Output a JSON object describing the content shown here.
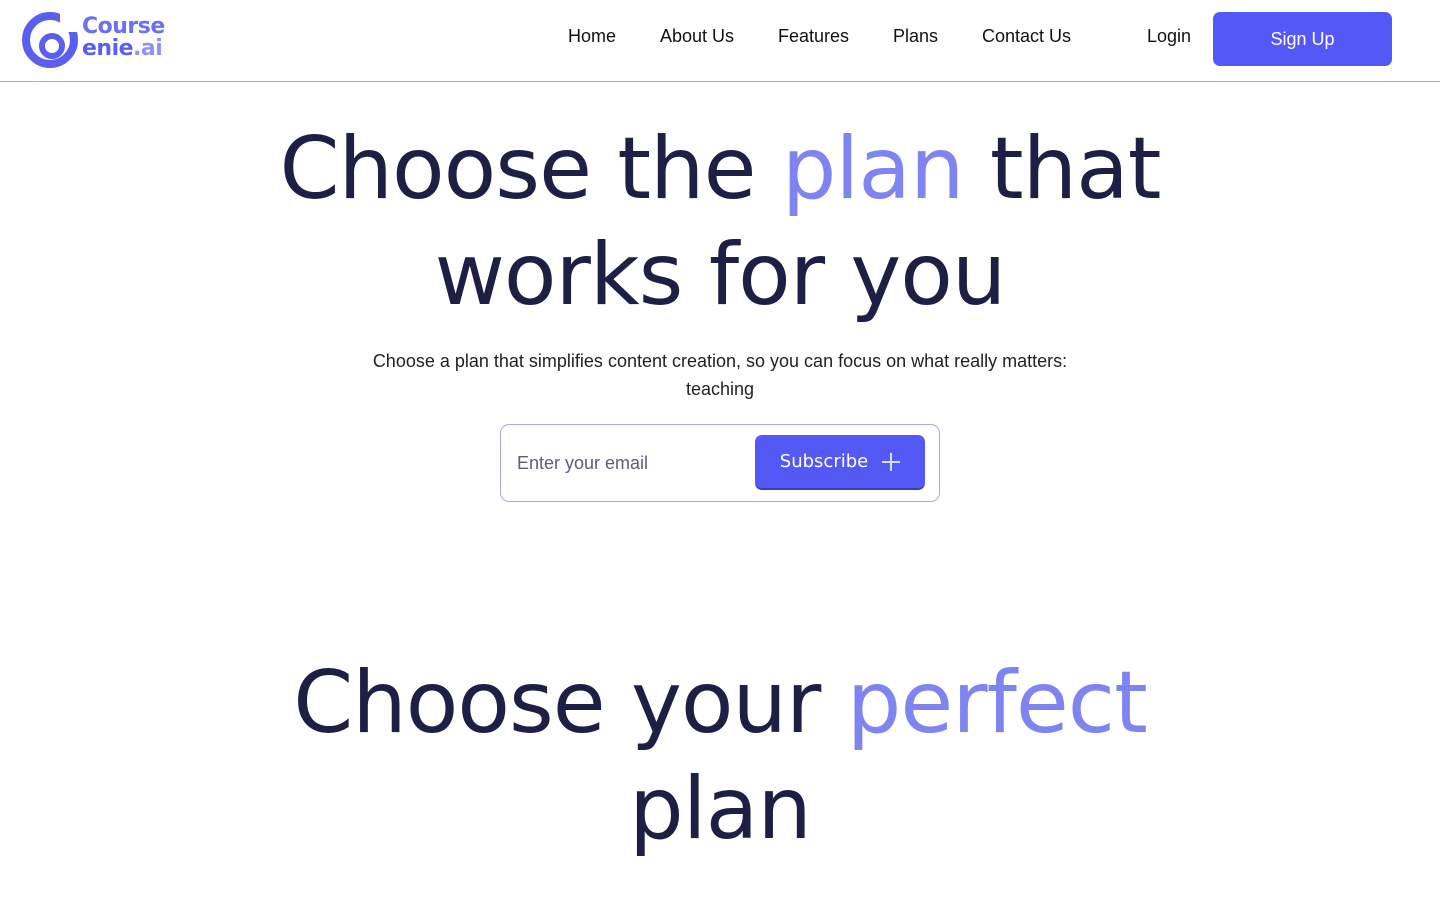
{
  "brand": {
    "name_line1": "Course",
    "name_line2": "enie",
    "name_suffix": ".ai",
    "primary_color": "#5458f4",
    "accent_color": "#7f85f0"
  },
  "nav": {
    "items": [
      {
        "label": "Home"
      },
      {
        "label": "About Us"
      },
      {
        "label": "Features"
      },
      {
        "label": "Plans"
      },
      {
        "label": "Contact Us"
      }
    ],
    "login_label": "Login",
    "signup_label": "Sign Up"
  },
  "hero": {
    "title_part1": "Choose the ",
    "title_accent": "plan",
    "title_part2": " that",
    "title_line2": "works for you",
    "subtitle": "Choose a plan that simplifies content creation, so you can focus on what really matters: teaching",
    "email_placeholder": "Enter your email",
    "email_value": "",
    "subscribe_label": "Subscribe",
    "subscribe_icon": "plus-icon"
  },
  "plans": {
    "title_part1": "Choose your ",
    "title_accent": "perfect",
    "title_line2": "plan"
  }
}
